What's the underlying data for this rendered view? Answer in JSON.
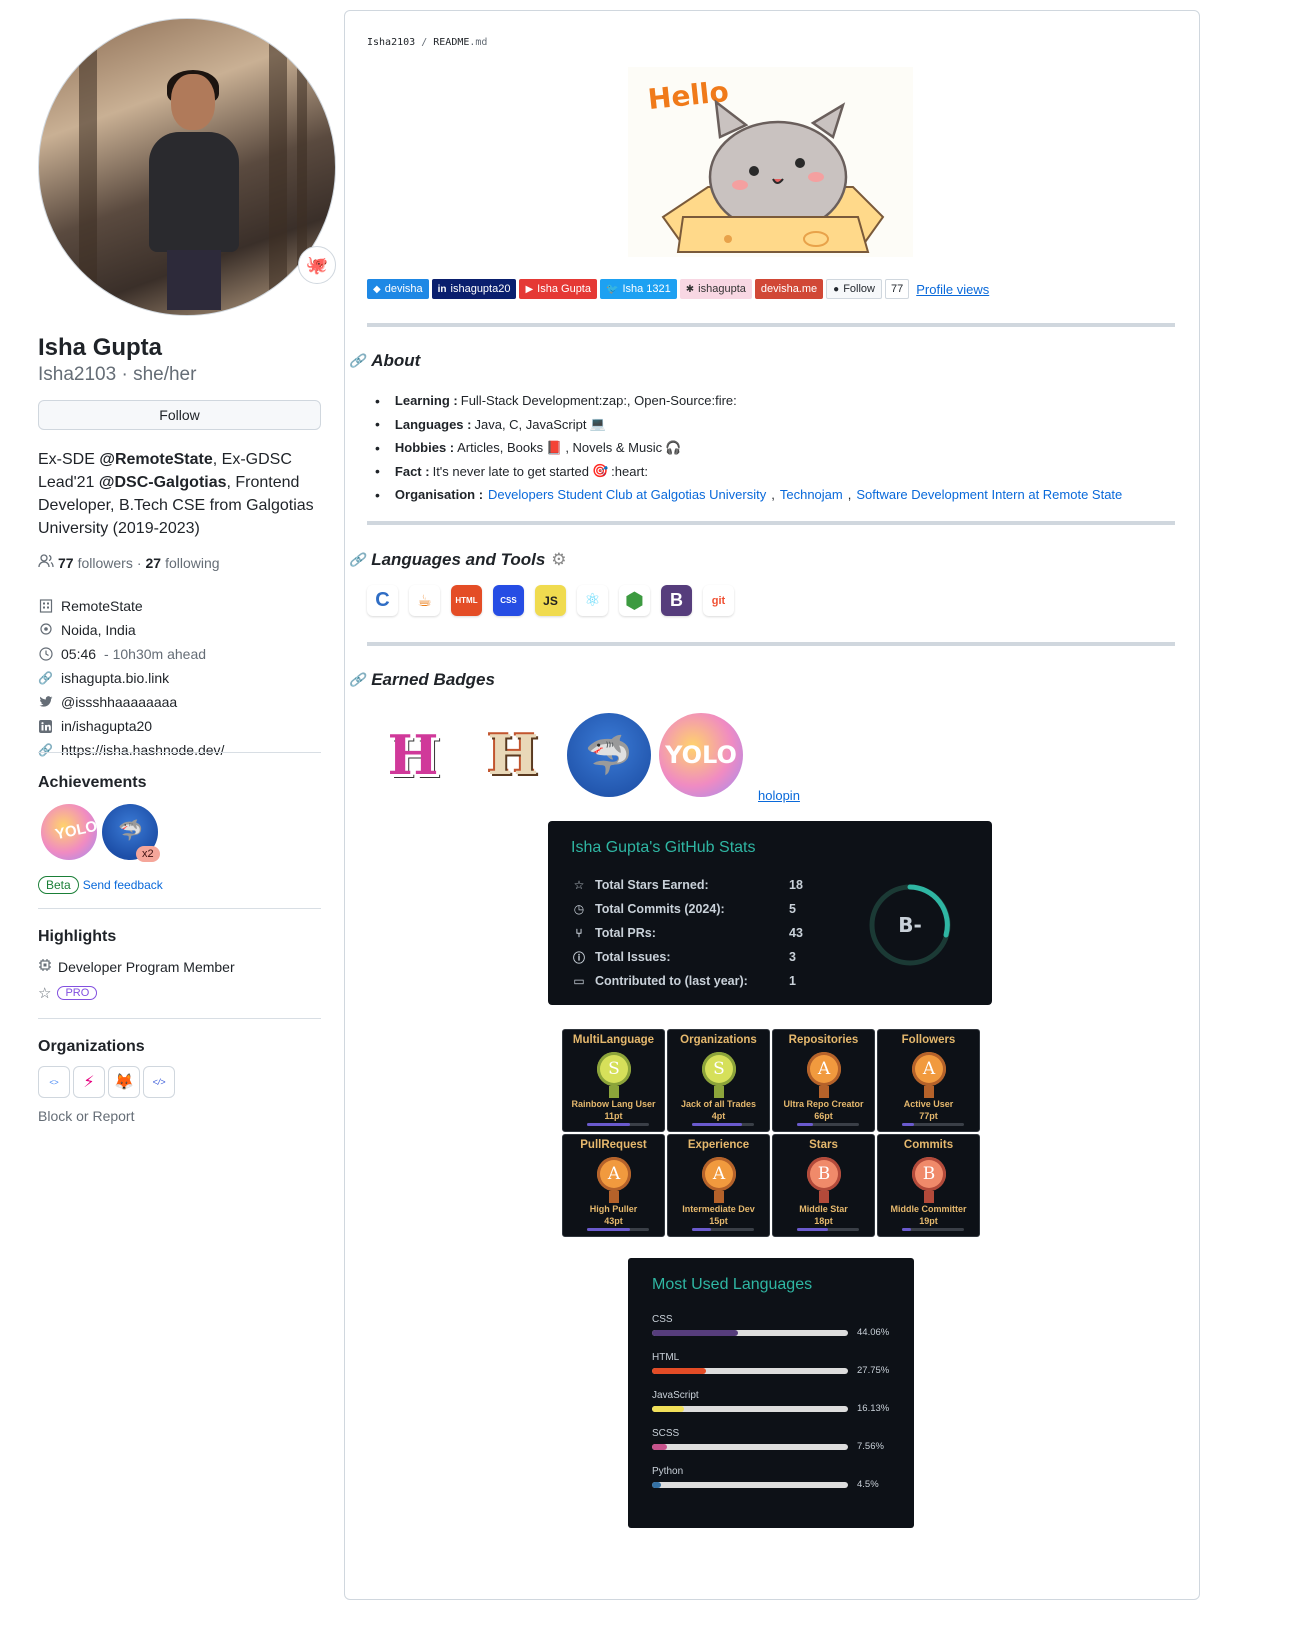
{
  "profile": {
    "name": "Isha Gupta",
    "handle": "Isha2103 · she/her",
    "follow_label": "Follow",
    "bio": {
      "p1": "Ex-SDE ",
      "b1": "@RemoteState",
      "p2": ", Ex-GDSC Lead'21 ",
      "b2": "@DSC-Galgotias",
      "p3": ", Frontend Developer, B.Tech CSE from Galgotias University (2019-2023)"
    },
    "followers_count": "77",
    "followers_label": "followers",
    "following_count": "27",
    "following_label": "following",
    "sep": "·",
    "info": {
      "company": "RemoteState",
      "location": "Noida, India",
      "time": "05:46",
      "time_suffix": "- 10h30m ahead",
      "website": "ishagupta.bio.link",
      "twitter": "@issshhaaaaaaaa",
      "linkedin": "in/ishagupta20",
      "blog": "https://isha.hashnode.dev/"
    },
    "emoji_icon": "octocat-face-icon"
  },
  "achievements": {
    "title": "Achievements",
    "multiplier": "x2",
    "beta_label": "Beta",
    "feedback_label": "Send feedback"
  },
  "highlights": {
    "title": "Highlights",
    "item1": "Developer Program Member",
    "pro_label": "PRO"
  },
  "organizations": {
    "title": "Organizations",
    "block_label": "Block or Report"
  },
  "readme": {
    "crumb_user": "Isha2103",
    "crumb_sep": "/",
    "crumb_file": "README",
    "crumb_ext": ".md",
    "hello_text": "Hello",
    "shields": [
      {
        "label": "devisha",
        "color": "#1e88e5"
      },
      {
        "label": "ishagupta20",
        "color": "#0a1f6e"
      },
      {
        "label": "Isha Gupta",
        "color": "#e53935"
      },
      {
        "label": "Isha 1321",
        "color": "#1da1f2"
      },
      {
        "label": "ishagupta",
        "color": "#f8d7e3"
      },
      {
        "label": "devisha.me",
        "color": "#d14836"
      }
    ],
    "gh_follow": "Follow",
    "gh_count": "77",
    "profile_views": "Profile views",
    "about_title": "About",
    "about": {
      "learning_k": "Learning :",
      "learning_v": "Full-Stack Development:zap:, Open-Source:fire:",
      "languages_k": "Languages :",
      "languages_v": "Java, C, JavaScript",
      "hobbies_k": "Hobbies :",
      "hobbies_v1": "Articles, Books",
      "hobbies_v2": ", Novels & Music",
      "fact_k": "Fact :",
      "fact_v1": "It's never late to get started",
      "fact_v2": ":heart:",
      "org_k": "Organisation :",
      "org_l1": "Developers Student Club at Galgotias University",
      "org_l2": "Technojam",
      "org_l3": "Software Development Intern at Remote State",
      "comma": ","
    },
    "tools_title": "Languages and Tools",
    "tools": [
      "C",
      "java",
      "HTML",
      "CSS",
      "JS",
      "react",
      "node",
      "B",
      "git"
    ],
    "badges_title": "Earned Badges",
    "holopin": "holopin"
  },
  "stats": {
    "title": "Isha Gupta's GitHub Stats",
    "rows": [
      {
        "label": "Total Stars Earned:",
        "value": "18",
        "icon": "star-icon"
      },
      {
        "label": "Total Commits (2024):",
        "value": "5",
        "icon": "history-icon"
      },
      {
        "label": "Total PRs:",
        "value": "43",
        "icon": "pull-request-icon"
      },
      {
        "label": "Total Issues:",
        "value": "3",
        "icon": "issue-icon"
      },
      {
        "label": "Contributed to (last year):",
        "value": "1",
        "icon": "repo-icon"
      }
    ],
    "grade": "B-",
    "accent": "#2fb6a3"
  },
  "trophies": [
    {
      "title": "MultiLanguage",
      "rank": "S",
      "sub": "Rainbow Lang User",
      "pts": "11pt",
      "progress": 0.7
    },
    {
      "title": "Organizations",
      "rank": "S",
      "sub": "Jack of all Trades",
      "pts": "4pt",
      "progress": 0.8
    },
    {
      "title": "Repositories",
      "rank": "A",
      "sub": "Ultra Repo Creator",
      "pts": "66pt",
      "progress": 0.25
    },
    {
      "title": "Followers",
      "rank": "A",
      "sub": "Active User",
      "pts": "77pt",
      "progress": 0.2
    },
    {
      "title": "PullRequest",
      "rank": "A",
      "sub": "High Puller",
      "pts": "43pt",
      "progress": 0.7
    },
    {
      "title": "Experience",
      "rank": "A",
      "sub": "Intermediate Dev",
      "pts": "15pt",
      "progress": 0.3
    },
    {
      "title": "Stars",
      "rank": "B",
      "sub": "Middle Star",
      "pts": "18pt",
      "progress": 0.5
    },
    {
      "title": "Commits",
      "rank": "B",
      "sub": "Middle Committer",
      "pts": "19pt",
      "progress": 0.15
    }
  ],
  "languages": {
    "title": "Most Used Languages",
    "items": [
      {
        "name": "CSS",
        "pct": "44.06%",
        "value": 44.06,
        "color": "#563d7c"
      },
      {
        "name": "HTML",
        "pct": "27.75%",
        "value": 27.75,
        "color": "#e34c26"
      },
      {
        "name": "JavaScript",
        "pct": "16.13%",
        "value": 16.13,
        "color": "#f1e05a"
      },
      {
        "name": "SCSS",
        "pct": "7.56%",
        "value": 7.56,
        "color": "#c6538c"
      },
      {
        "name": "Python",
        "pct": "4.5%",
        "value": 4.5,
        "color": "#3572a5"
      }
    ]
  }
}
